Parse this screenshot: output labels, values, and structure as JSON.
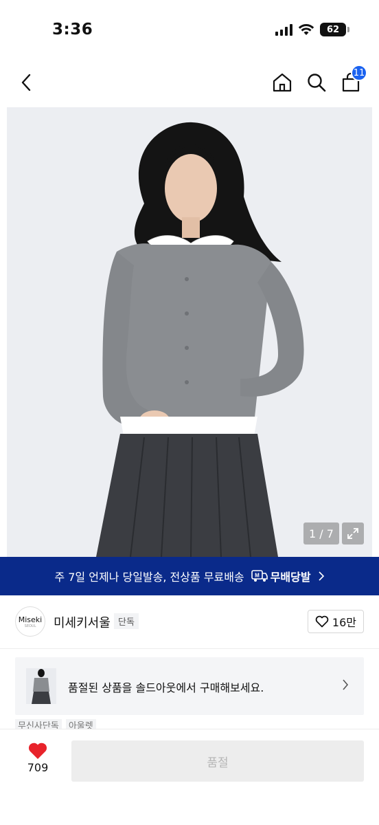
{
  "status_bar": {
    "time": "3:36",
    "battery": "62"
  },
  "nav": {
    "cart_count": "11"
  },
  "image": {
    "counter": "1 / 7"
  },
  "promo": {
    "text": "주 7일 언제나 당일발송, 전상품 무료배송",
    "logo_text": "무배당발",
    "logo_mark": "M"
  },
  "brand": {
    "logo_text": "Miseki",
    "logo_sub": "SEOUL",
    "name": "미세키서울",
    "tag": "단독",
    "like_count": "16만"
  },
  "soldout_card": {
    "text": "품절된 상품을 솔드아웃에서 구매해보세요."
  },
  "tags": [
    "무신사단독",
    "아울렛"
  ],
  "bottom": {
    "wish_count": "709",
    "soldout_label": "품절"
  },
  "colors": {
    "banner": "#0a2a8a",
    "cart_badge": "#1a62f0",
    "heart": "#e8232b"
  },
  "icons": [
    "back-icon",
    "home-icon",
    "search-icon",
    "bag-icon",
    "expand-icon",
    "heart-outline-icon",
    "chevron-right-icon",
    "heart-filled-icon"
  ]
}
